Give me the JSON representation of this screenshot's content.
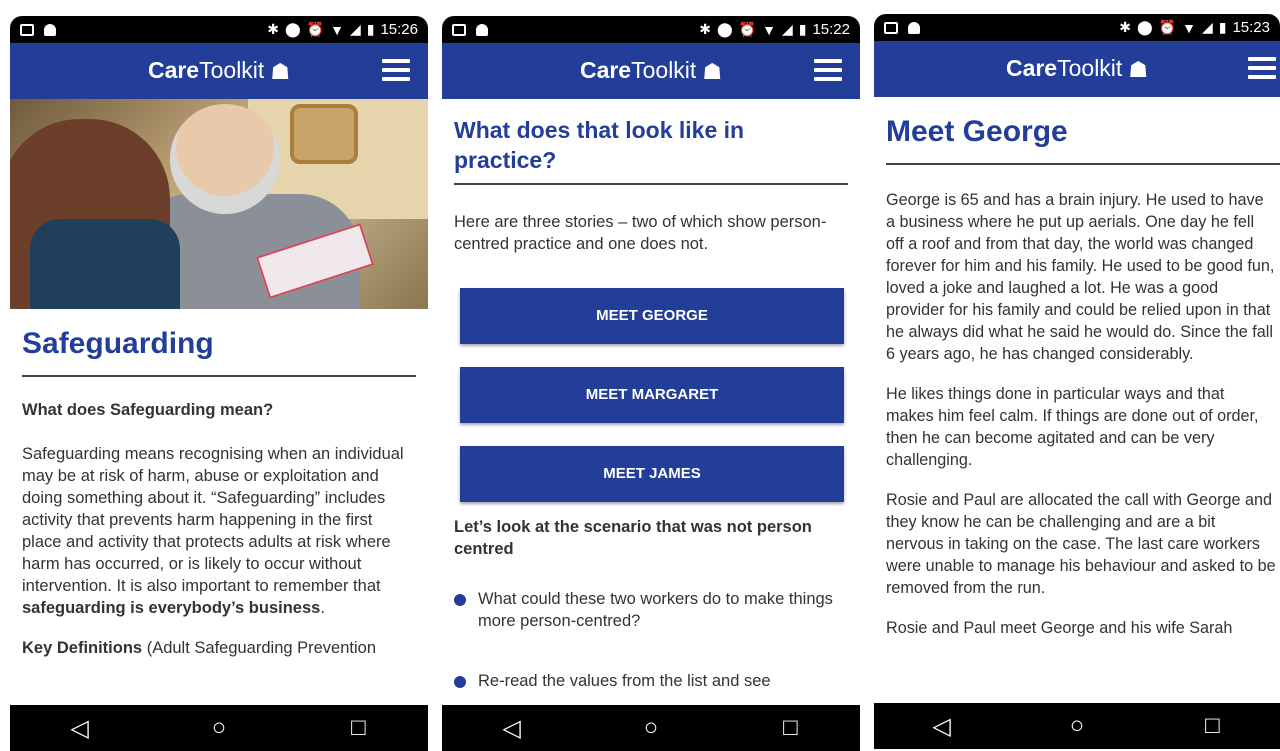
{
  "app": {
    "brand_bold": "Care",
    "brand_regular": "Toolkit"
  },
  "screens": [
    {
      "time": "15:26",
      "title": "Safeguarding",
      "question": "What does Safeguarding mean?",
      "body_text": "Safeguarding means recognising when an individual may be at risk of harm, abuse or exploitation and doing something about it. “Safeguarding” includes activity that prevents harm happening in the first place and activity that protects adults at risk where harm has occurred, or is likely to occur without intervention. It is also important to remember that ",
      "body_bold": "safeguarding is everybody’s business",
      "body_end": ".",
      "key_label": "Key Definitions",
      "key_rest": " (Adult Safeguarding Prevention"
    },
    {
      "time": "15:22",
      "title": "What does that look like in practice?",
      "intro": "Here are three stories – two of which show person-centred practice and one does not.",
      "buttons": [
        "MEET GEORGE",
        "MEET MARGARET",
        "MEET JAMES"
      ],
      "subheading": "Let’s look at the scenario that was not person centred",
      "bullets": [
        "What could these two workers do to make things more person-centred?",
        "Re-read the values from the list and see"
      ]
    },
    {
      "time": "15:23",
      "title": "Meet George",
      "paragraphs": [
        "George is 65 and has a brain injury. He used to have a business where he put up aerials. One day he fell off a roof and from that day, the world was changed forever for him and his family. He used to be good fun, loved a joke and laughed a lot. He was a good provider for his family and could be relied upon in that he always did what he said he would do. Since the fall 6 years ago, he has changed considerably.",
        "He likes things done in particular ways and that makes him feel calm. If things are done out of order, then he can become agitated and can be very challenging.",
        "Rosie and Paul are allocated the call with George and they know he can be challenging and are a bit nervous in taking on the case. The last care workers were unable to manage his behaviour and asked to be removed from the run.",
        "Rosie and Paul meet George and his wife Sarah"
      ]
    }
  ],
  "nav": {
    "back": "◁",
    "home": "○",
    "recent": "□"
  }
}
